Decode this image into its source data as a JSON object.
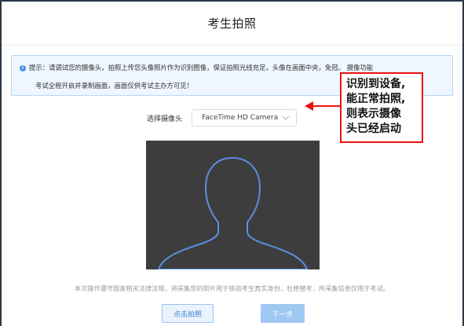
{
  "dialog": {
    "title": "考生拍照"
  },
  "notice": {
    "icon": "info-icon",
    "line1": "提示：请调试您的摄像头，拍照上传您头像照片作为识别图像，保证拍照光线充足，头像在画面中央，免冠。 摄像功能",
    "line2": "考试全程开启并录制画面，画面仅供考试主办方可见！"
  },
  "camera": {
    "label": "选择摄像头",
    "selected": "FaceTime HD Camera"
  },
  "footnote": "本次操作遵守国家相关法律法规，将采集您的照片用于核验考生真实身份，杜绝替考，所采集信息仅用于考试。",
  "buttons": {
    "capture": "点击拍照",
    "next": "下一步"
  },
  "annotation": {
    "lines": [
      "识别到设备,",
      "能正常拍照,",
      "则表示摄像",
      "头已经启动"
    ],
    "border_color": "#e11111"
  },
  "colors": {
    "accent": "#4a90e2",
    "next_button": "#9fc8f3",
    "preview_bg": "#3d3d3d",
    "silhouette": "#5b8fe0"
  }
}
